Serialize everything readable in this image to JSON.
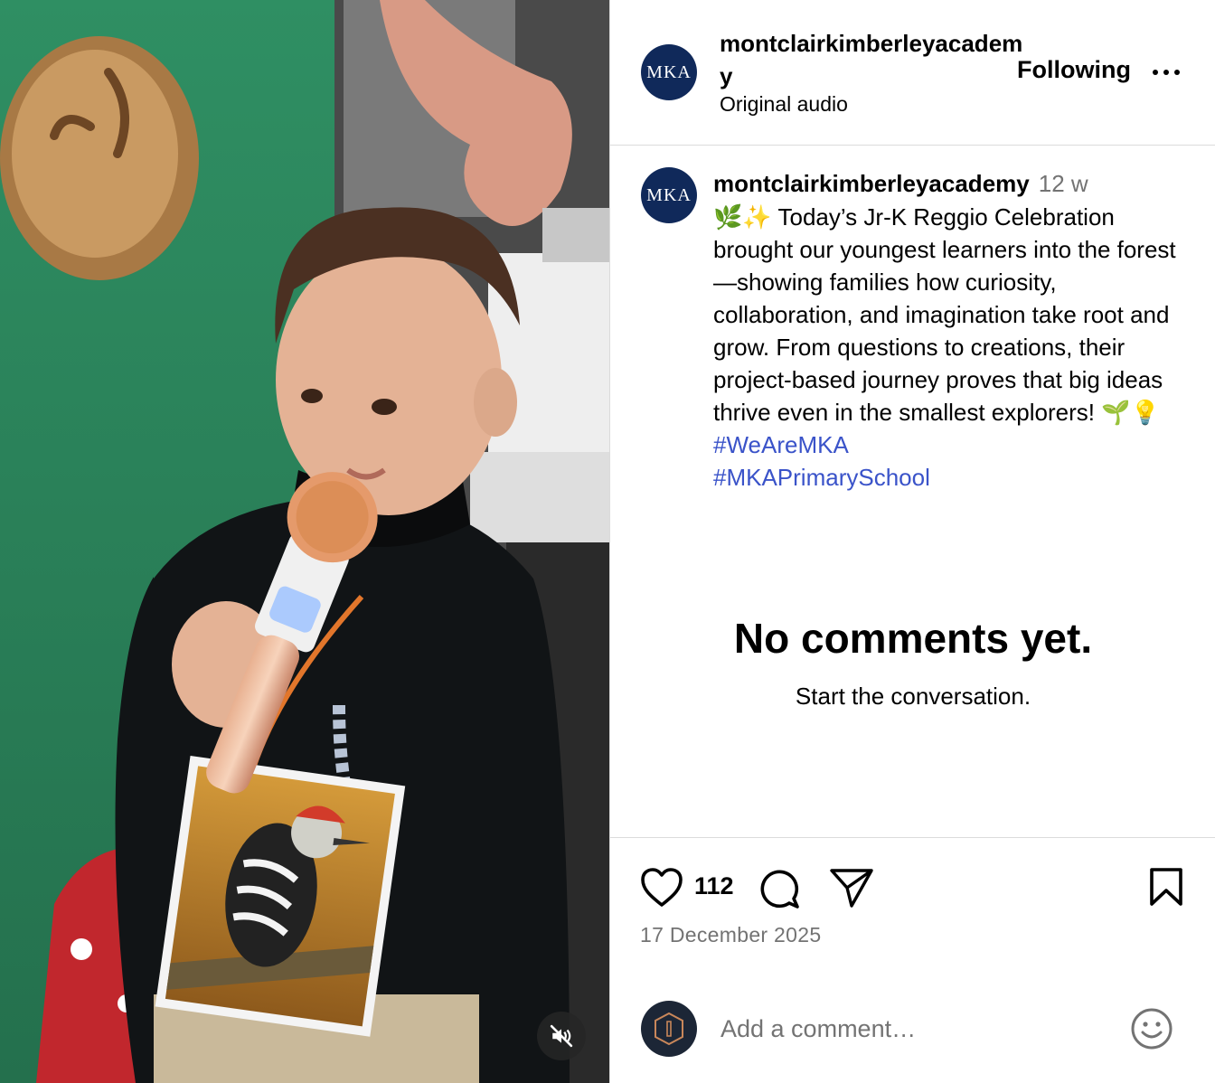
{
  "post": {
    "media_alt": "Young child speaking into a rose-gold karaoke microphone, wearing a picture of a red-bellied woodpecker on a beaded lanyard",
    "mute_icon": "speaker-muted-icon"
  },
  "header": {
    "avatar_text": "MKA",
    "username": "montclairkimberleyacademy",
    "audio": "Original audio",
    "following_label": "Following",
    "more_icon": "more-horizontal-icon"
  },
  "caption": {
    "avatar_text": "MKA",
    "username": "montclairkimberleyacademy",
    "time": "12 w",
    "text_lead": "🌿✨ Today’s Jr-K Reggio Celebration brought our youngest learners into the forest—showing families how curiosity, collaboration, and imagination take root and grow. From questions to creations, their project-based journey proves that big ideas thrive even in the smallest explorers! 🌱💡 ",
    "hashtags": [
      "#WeAreMKA",
      "#MKAPrimarySchool"
    ]
  },
  "comments": {
    "empty_title": "No comments yet.",
    "empty_subtitle": "Start the conversation."
  },
  "actions": {
    "like_count": "112",
    "date": "17 December 2025",
    "icons": [
      "heart-icon",
      "comment-icon",
      "share-icon",
      "bookmark-icon"
    ]
  },
  "comment_box": {
    "placeholder": "Add a comment…",
    "emoji_icon": "emoji-icon"
  },
  "colors": {
    "brand_navy": "#10295a",
    "hashtag": "#3a53c9",
    "secondary_text": "#737373",
    "divider": "#dbdbdb"
  }
}
